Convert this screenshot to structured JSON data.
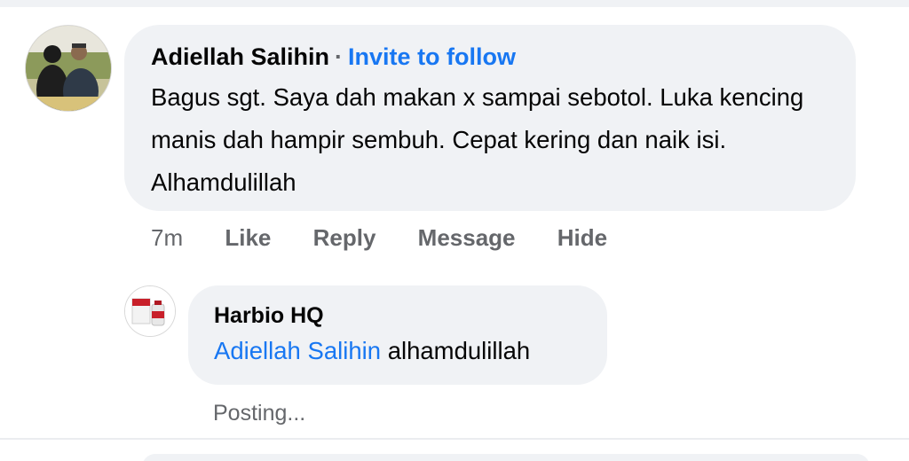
{
  "comment": {
    "author": "Adiellah Salihin",
    "separator": "·",
    "invite_label": "Invite to follow",
    "text": "Bagus sgt. Saya dah makan x sampai sebotol. Luka kencing manis dah hampir sembuh. Cepat kering dan naik isi. Alhamdulillah",
    "actions": {
      "time": "7m",
      "like": "Like",
      "reply": "Reply",
      "message": "Message",
      "hide": "Hide"
    }
  },
  "reply": {
    "author": "Harbio HQ",
    "mention": "Adiellah Salihin",
    "text": "alhamdulillah",
    "status": "Posting..."
  },
  "colors": {
    "link": "#1877f2",
    "bubble": "#f0f2f5",
    "secondary_text": "#65676b"
  }
}
